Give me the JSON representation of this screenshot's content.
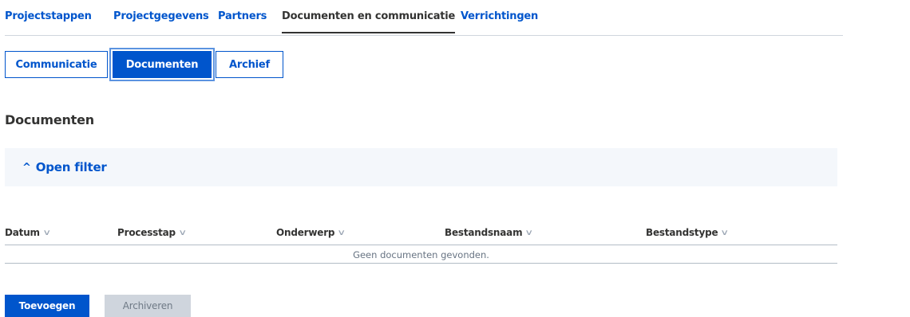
{
  "tabs": [
    {
      "label": "Projectstappen",
      "active": false
    },
    {
      "label": "Projectgegevens",
      "active": false
    },
    {
      "label": "Partners",
      "active": false
    },
    {
      "label": "Documenten en communicatie",
      "active": true
    },
    {
      "label": "Verrichtingen",
      "active": false
    }
  ],
  "subtabs": [
    {
      "label": "Communicatie",
      "active": false
    },
    {
      "label": "Documenten",
      "active": true
    },
    {
      "label": "Archief",
      "active": false
    }
  ],
  "section_title": "Documenten",
  "filter": {
    "caret_icon": "chevron-up-icon",
    "caret": "^",
    "label": "Open filter"
  },
  "table": {
    "sort_icon": "chevron-down-icon",
    "sort_glyph": "∨",
    "columns": [
      "Datum",
      "Processtap",
      "Onderwerp",
      "Bestandsnaam",
      "Bestandstype"
    ],
    "empty_text": "Geen documenten gevonden."
  },
  "actions": {
    "add_label": "Toevoegen",
    "archive_label": "Archiveren",
    "archive_disabled": true
  },
  "colors": {
    "primary": "#0055cc",
    "text": "#333332",
    "filter_bg": "#f4f7fb",
    "disabled_bg": "#cfd5dd"
  }
}
